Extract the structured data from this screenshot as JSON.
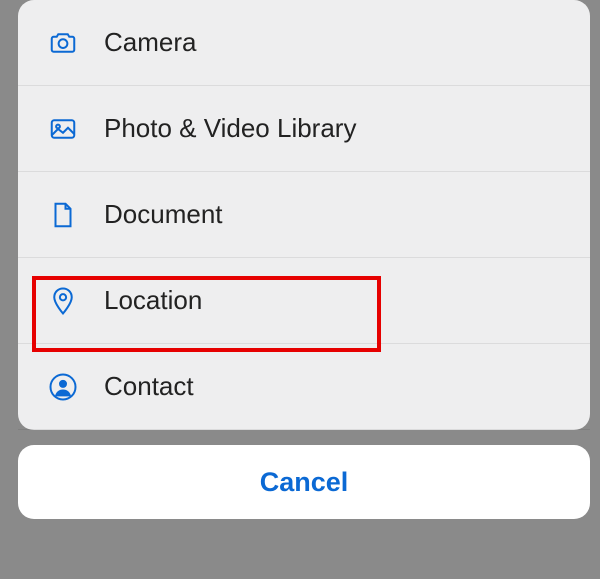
{
  "menu": {
    "items": [
      {
        "label": "Camera",
        "icon": "camera-icon"
      },
      {
        "label": "Photo & Video Library",
        "icon": "photo-icon"
      },
      {
        "label": "Document",
        "icon": "document-icon"
      },
      {
        "label": "Location",
        "icon": "location-icon"
      },
      {
        "label": "Contact",
        "icon": "contact-icon"
      }
    ]
  },
  "cancel_label": "Cancel",
  "colors": {
    "accent": "#0b69d4",
    "highlight": "#e60000"
  }
}
